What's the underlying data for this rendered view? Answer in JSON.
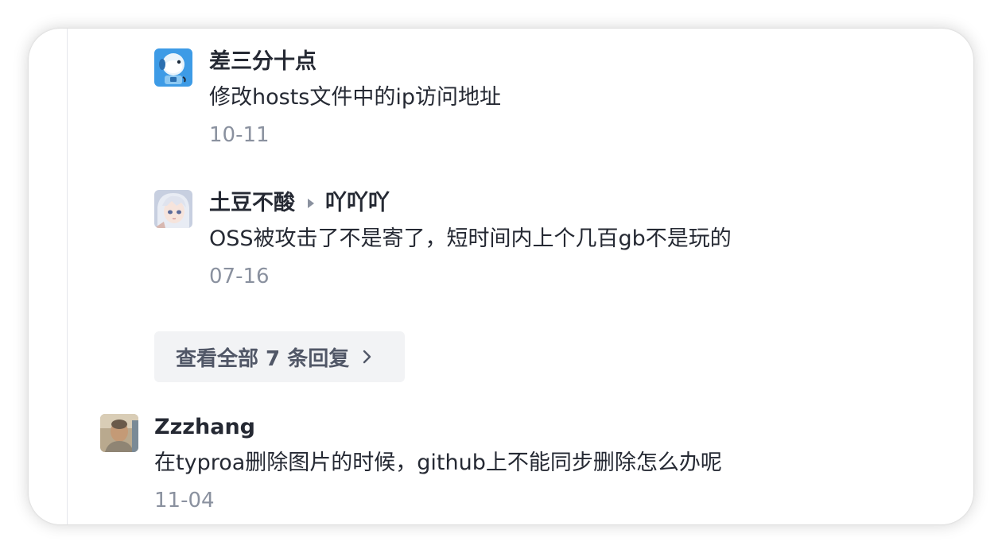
{
  "comments": [
    {
      "author": "差三分十点",
      "reply_to": "",
      "text": "修改hosts文件中的ip访问地址",
      "date": "10-11",
      "avatar": "dog-avatar"
    },
    {
      "author": "土豆不酸",
      "reply_to": "吖吖吖",
      "text": "OSS被攻击了不是寄了，短时间内上个几百gb不是玩的",
      "date": "07-16",
      "avatar": "anime-avatar"
    }
  ],
  "view_all": {
    "label": "查看全部 7 条回复",
    "icon": "chevron-right-icon"
  },
  "top_comment": {
    "author": "Zzzhang",
    "text": "在typroa删除图片的时候，github上不能同步删除怎么办呢",
    "date": "11-04",
    "avatar": "person-photo-avatar"
  },
  "colors": {
    "text": "#252933",
    "muted": "#8a919f",
    "button_bg": "#f2f3f5",
    "button_text": "#515767"
  }
}
